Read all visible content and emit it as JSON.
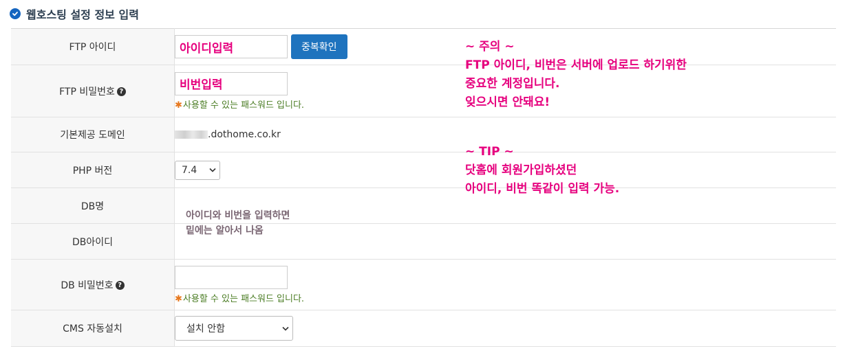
{
  "section": {
    "title": "웹호스팅 설정 정보 입력"
  },
  "rows": {
    "ftp_id": {
      "label": "FTP 아이디",
      "value": "아이디입력",
      "button": "중복확인"
    },
    "ftp_pw": {
      "label": "FTP 비밀번호",
      "value": "비번입력",
      "hint": "사용할 수 있는 패스워드 입니다."
    },
    "domain": {
      "label": "기본제공 도메인",
      "value": ".dothome.co.kr"
    },
    "php": {
      "label": "PHP 버전",
      "selected": "7.4"
    },
    "db_name": {
      "label": "DB명"
    },
    "db_id": {
      "label": "DB아이디"
    },
    "db_pw": {
      "label": "DB 비밀번호",
      "value": "",
      "hint": "사용할 수 있는 패스워드 입니다."
    },
    "cms": {
      "label": "CMS 자동설치",
      "selected": "설치 안함"
    }
  },
  "annotations": {
    "caution": [
      "~ 주의 ~",
      "FTP 아이디, 비번은 서버에 업로드 하기위한",
      "중요한 계정입니다.",
      "잊으시면 안돼요!"
    ],
    "tip": [
      "~ TIP ~",
      "닷홈에 회원가입하셨던",
      "아이디, 비번 똑같이 입력 가능."
    ],
    "db_note": [
      "아이디와 비번을 입력하면",
      "밑에는 알아서 나옴"
    ]
  },
  "colors": {
    "accent": "#e6007e",
    "button": "#1e73be",
    "hint": "#4a7c23"
  },
  "icons": {
    "title": "check-circle-icon",
    "help": "question-circle-icon",
    "dropdown": "chevron-down-icon"
  }
}
